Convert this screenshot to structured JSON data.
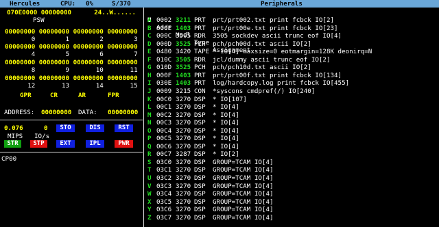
{
  "titlebar": {
    "app": "Hercules",
    "cpu_label": "CPU:",
    "cpu_value": "0%",
    "model": "S/370",
    "peripherals": "Peripherals"
  },
  "regs": {
    "psw_line": "070E0000 00000000      24..W......",
    "psw_label": "PSW",
    "rows": [
      {
        "vals": "00000000 00000000 00000000 00000000",
        "nums": "       0        1        2        3"
      },
      {
        "vals": "00000000 00000000 00000000 00000000",
        "nums": "       4        5        6        7"
      },
      {
        "vals": "00000000 00000000 00000000 00000000",
        "nums": "       8        9       10       11"
      },
      {
        "vals": "00000000 00000000 00000000 00000000",
        "nums": "      12       13       14       15"
      }
    ],
    "sel_gpr": "GPR",
    "sel_cr": "CR",
    "sel_ar": "AR",
    "sel_fpr": "FPR",
    "address_label": "ADDRESS:",
    "address_value": "00000000",
    "data_label": "DATA:",
    "data_value": "00000000"
  },
  "stats": {
    "mips_value": "0.076",
    "ios_value": "0",
    "mips_label": "MIPS",
    "ios_label": "IO/s"
  },
  "buttons": {
    "sto": "STO",
    "dis": "DIS",
    "rst": "RST",
    "str": "STR",
    "stp": "STP",
    "ext": "EXT",
    "ipl": "IPL",
    "pwr": "PWR"
  },
  "cpu_id": "CP00",
  "peripherals": {
    "header": {
      "key": "U",
      "addr": "Addr",
      "modl": "Modl",
      "type": "Type",
      "assign": "Assignment"
    },
    "rows": [
      {
        "key": "A",
        "addr": "0002",
        "modl": "3211",
        "type": "PRT",
        "assign": "prt/prt002.txt print fcbck IO[2]",
        "green": true
      },
      {
        "key": "B",
        "addr": "000E",
        "modl": "1403",
        "type": "PRT",
        "assign": "prt/prt00e.txt print fcbck IO[23]",
        "green": true
      },
      {
        "key": "C",
        "addr": "000C",
        "modl": "3505",
        "type": "RDR",
        "assign": "3505 sockdev ascii trunc eof IO[4]",
        "green": false
      },
      {
        "key": "D",
        "addr": "000D",
        "modl": "3525",
        "type": "PCH",
        "assign": "pch/pch00d.txt ascii IO[2]",
        "green": true
      },
      {
        "key": "E",
        "addr": "0480",
        "modl": "3420",
        "type": "TAPE",
        "assign": "* IO[4] maxsize=0 eotmargin=128K deonirq=N",
        "green": false
      },
      {
        "key": "F",
        "addr": "010C",
        "modl": "3505",
        "type": "RDR",
        "assign": "jcl/dummy ascii trunc eof IO[2]",
        "green": true
      },
      {
        "key": "G",
        "addr": "010D",
        "modl": "3525",
        "type": "PCH",
        "assign": "pch/pch10d.txt ascii IO[2]",
        "green": true
      },
      {
        "key": "H",
        "addr": "000F",
        "modl": "1403",
        "type": "PRT",
        "assign": "prt/prt00f.txt print fcbck IO[134]",
        "green": true
      },
      {
        "key": "I",
        "addr": "030E",
        "modl": "1403",
        "type": "PRT",
        "assign": "log/hardcopy.log print fcbck IO[455]",
        "green": true
      },
      {
        "key": "J",
        "addr": "0009",
        "modl": "3215",
        "type": "CON",
        "assign": "*syscons cmdpref(/) IO[240]",
        "green": false
      },
      {
        "key": "K",
        "addr": "00C0",
        "modl": "3270",
        "type": "DSP",
        "assign": "* IO[107]",
        "green": false
      },
      {
        "key": "L",
        "addr": "00C1",
        "modl": "3270",
        "type": "DSP",
        "assign": "* IO[4]",
        "green": false
      },
      {
        "key": "M",
        "addr": "00C2",
        "modl": "3270",
        "type": "DSP",
        "assign": "* IO[4]",
        "green": false
      },
      {
        "key": "N",
        "addr": "00C3",
        "modl": "3270",
        "type": "DSP",
        "assign": "* IO[4]",
        "green": false
      },
      {
        "key": "O",
        "addr": "00C4",
        "modl": "3270",
        "type": "DSP",
        "assign": "* IO[4]",
        "green": false
      },
      {
        "key": "P",
        "addr": "00C5",
        "modl": "3270",
        "type": "DSP",
        "assign": "* IO[4]",
        "green": false
      },
      {
        "key": "Q",
        "addr": "00C6",
        "modl": "3270",
        "type": "DSP",
        "assign": "* IO[4]",
        "green": false
      },
      {
        "key": "R",
        "addr": "00C7",
        "modl": "3287",
        "type": "DSP",
        "assign": "* IO[2]",
        "green": false
      },
      {
        "key": "S",
        "addr": "03C0",
        "modl": "3270",
        "type": "DSP",
        "assign": "GROUP=TCAM IO[4]",
        "green": false
      },
      {
        "key": "T",
        "addr": "03C1",
        "modl": "3270",
        "type": "DSP",
        "assign": "GROUP=TCAM IO[4]",
        "green": false
      },
      {
        "key": "U",
        "addr": "03C2",
        "modl": "3270",
        "type": "DSP",
        "assign": "GROUP=TCAM IO[4]",
        "green": false
      },
      {
        "key": "V",
        "addr": "03C3",
        "modl": "3270",
        "type": "DSP",
        "assign": "GROUP=TCAM IO[4]",
        "green": false
      },
      {
        "key": "W",
        "addr": "03C4",
        "modl": "3270",
        "type": "DSP",
        "assign": "GROUP=TCAM IO[4]",
        "green": false
      },
      {
        "key": "X",
        "addr": "03C5",
        "modl": "3270",
        "type": "DSP",
        "assign": "GROUP=TCAM IO[4]",
        "green": false
      },
      {
        "key": "Y",
        "addr": "03C6",
        "modl": "3270",
        "type": "DSP",
        "assign": "GROUP=TCAM IO[4]",
        "green": false
      },
      {
        "key": "Z",
        "addr": "03C7",
        "modl": "3270",
        "type": "DSP",
        "assign": "GROUP=TCAM IO[4]",
        "green": false
      }
    ]
  }
}
